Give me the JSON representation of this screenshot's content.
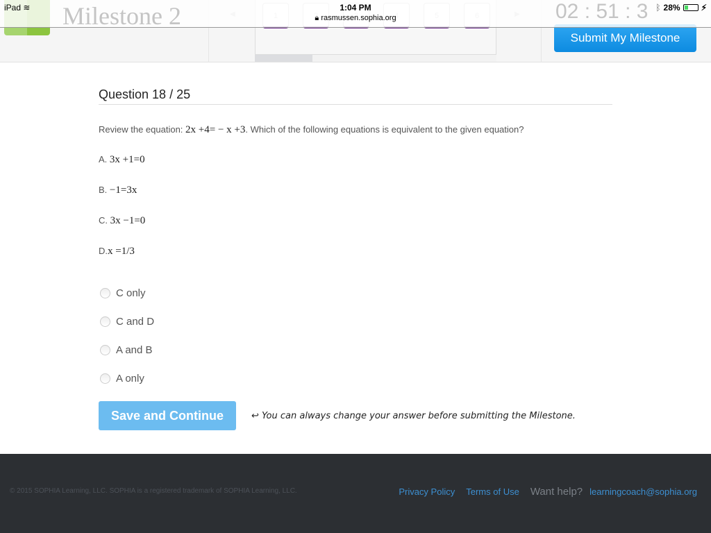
{
  "status_bar": {
    "device": "iPad",
    "time": "1:04 PM",
    "url": "rasmussen.sophia.org",
    "battery": "28%",
    "battery_level": 0.28
  },
  "header": {
    "title": "Milestone 2",
    "pages": [
      "1",
      "2",
      "3",
      "4",
      "5",
      "6"
    ],
    "timer": "02 : 51 : 3",
    "submit_label": "Submit My Milestone",
    "accent": "#1a96e8"
  },
  "question": {
    "title": "Question 18 / 25",
    "prompt_pre": "Review the equation: ",
    "prompt_eq": "2x +4= − x +3",
    "prompt_post": ". Which of the following equations is equivalent to the given equation?",
    "options": [
      {
        "label": "A.",
        "eq": "3x +1=0"
      },
      {
        "label": "B.",
        "eq": "−1=3x"
      },
      {
        "label": "C.",
        "eq": "3x −1=0"
      },
      {
        "label": "D.",
        "eq": "x =1/3"
      }
    ],
    "choices": [
      "C only",
      "C and D",
      "A and B",
      "A only"
    ]
  },
  "actions": {
    "save_label": "Save and Continue",
    "hint": "You can always change your answer before submitting the Milestone."
  },
  "footer": {
    "copyright": "© 2015 SOPHIA Learning, LLC. SOPHIA is a registered trademark of SOPHIA Learning, LLC.",
    "privacy": "Privacy Policy",
    "terms": "Terms of Use",
    "help": "Want help?",
    "email": "learningcoach@sophia.org"
  }
}
